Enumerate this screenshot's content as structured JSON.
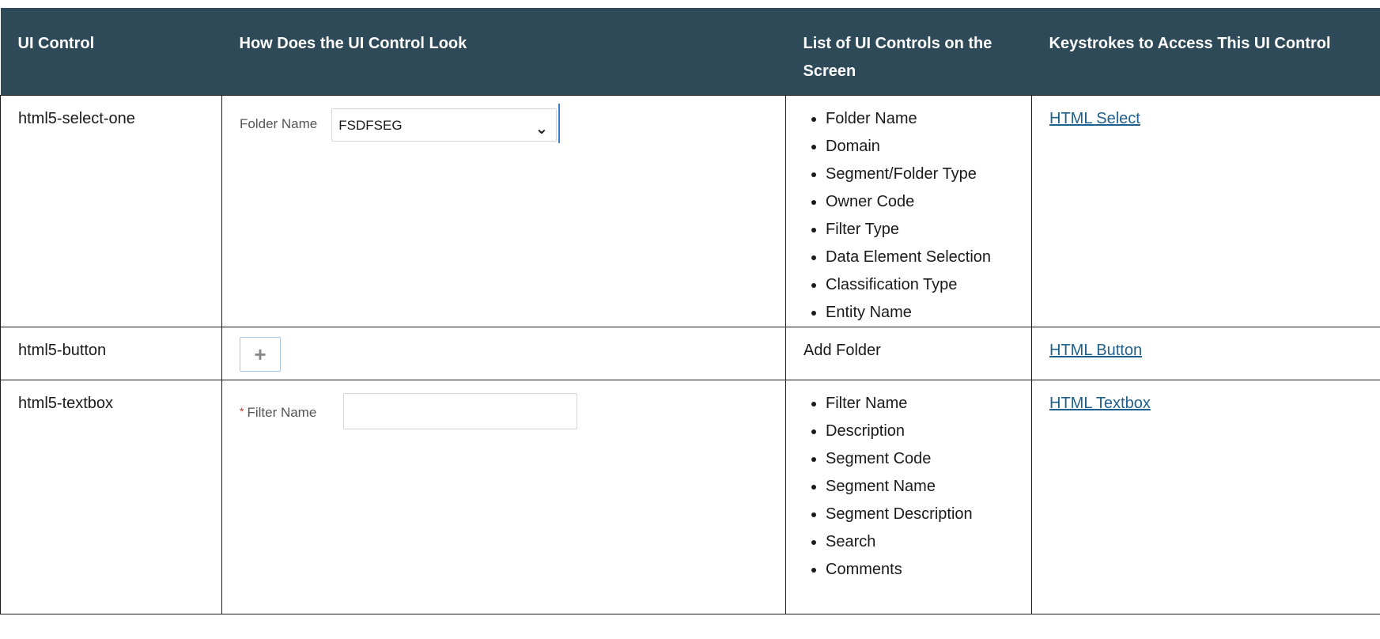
{
  "header": {
    "col1": "UI Control",
    "col2": "How Does the UI Control Look",
    "col3": "List of UI Controls on the Screen",
    "col4": "Keystrokes to Access This UI Control"
  },
  "rows": [
    {
      "control": "html5-select-one",
      "mock": {
        "label": "Folder Name",
        "value": "FSDFSEG",
        "icon": "chevron-down-icon"
      },
      "controls_list": [
        "Folder Name",
        "Domain",
        "Segment/Folder Type",
        "Owner Code",
        "Filter Type",
        "Data Element Selection",
        "Classification Type",
        "Entity Name"
      ],
      "link": "HTML Select"
    },
    {
      "control": "html5-button",
      "mock": {
        "symbol": "+",
        "icon": "plus-icon"
      },
      "controls_text": "Add Folder",
      "link": "HTML Button"
    },
    {
      "control": "html5-textbox",
      "mock": {
        "required_mark": "*",
        "label": "Filter Name",
        "value": ""
      },
      "controls_list": [
        "Filter Name",
        "Description",
        "Segment Code",
        "Segment Name",
        "Segment Description",
        "Search",
        "Comments"
      ],
      "link": "HTML Textbox"
    }
  ]
}
